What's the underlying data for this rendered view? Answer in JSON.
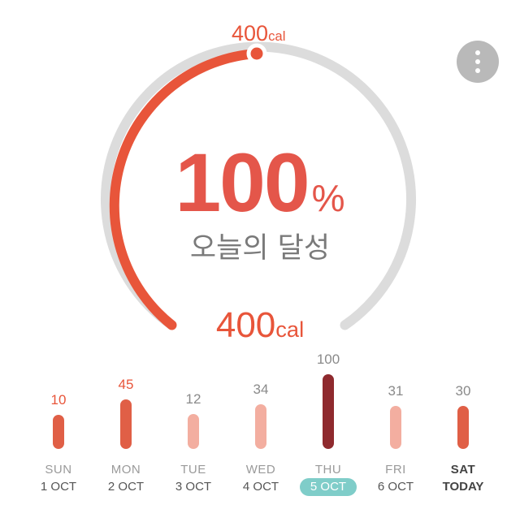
{
  "gauge": {
    "goal_value": "400",
    "goal_unit": "cal",
    "progress_fraction": 1.0,
    "percent_value": "100",
    "percent_sign": "%",
    "subtitle": "오늘의 달성",
    "consumed_value": "400",
    "consumed_unit": "cal"
  },
  "menu": {
    "icon": "more-vertical-icon"
  },
  "colors": {
    "accent": "#e8553a",
    "track": "#dcdcdc",
    "bar_high": "#e05f46",
    "bar_low": "#f3aea0",
    "bar_max": "#8f2a2e",
    "selected_date": "#7fcdc9"
  },
  "week": [
    {
      "day": "SUN",
      "date": "1 OCT",
      "value": "10"
    },
    {
      "day": "MON",
      "date": "2 OCT",
      "value": "45"
    },
    {
      "day": "TUE",
      "date": "3 OCT",
      "value": "12"
    },
    {
      "day": "WED",
      "date": "4 OCT",
      "value": "34"
    },
    {
      "day": "THU",
      "date": "5 OCT",
      "value": "100"
    },
    {
      "day": "FRI",
      "date": "6 OCT",
      "value": "31"
    },
    {
      "day": "SAT",
      "date": "TODAY",
      "value": "30"
    }
  ]
}
